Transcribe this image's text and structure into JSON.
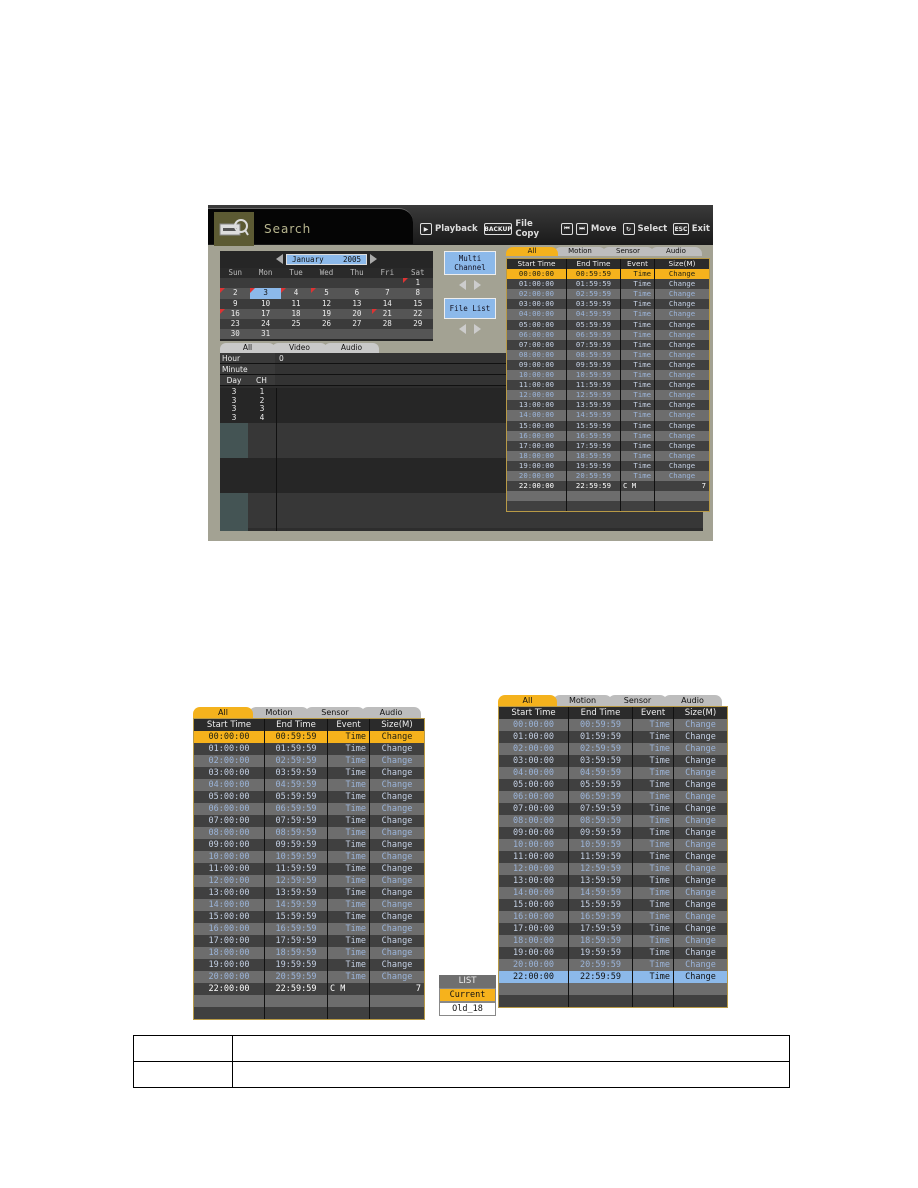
{
  "screen": {
    "title": "Search",
    "help": [
      {
        "key": "play-key",
        "icon": "▶",
        "label": "Playback"
      },
      {
        "key": "backup-key",
        "icon": "BACKUP",
        "label": "File Copy"
      },
      {
        "key": "move-keys",
        "icon": "◀▶",
        "label": "Move"
      },
      {
        "key": "select-key",
        "icon": "↻",
        "label": "Select"
      },
      {
        "key": "esc-key",
        "icon": "ESC",
        "label": "Exit"
      }
    ],
    "calendar": {
      "month": "January",
      "year": "2005",
      "weekdays": [
        "Sun",
        "Mon",
        "Tue",
        "Wed",
        "Thu",
        "Fri",
        "Sat"
      ],
      "weeks": [
        [
          "",
          "",
          "",
          "",
          "",
          "",
          "1"
        ],
        [
          "2",
          "3",
          "4",
          "5",
          "6",
          "7",
          "8"
        ],
        [
          "9",
          "10",
          "11",
          "12",
          "13",
          "14",
          "15"
        ],
        [
          "16",
          "17",
          "18",
          "19",
          "20",
          "21",
          "22"
        ],
        [
          "23",
          "24",
          "25",
          "26",
          "27",
          "28",
          "29"
        ],
        [
          "30",
          "31",
          "",
          "",
          "",
          "",
          ""
        ]
      ],
      "selected_day": "3",
      "marked_days": [
        "1",
        "2",
        "3",
        "4",
        "5",
        "16",
        "21"
      ]
    },
    "buttons": {
      "multi_channel": "Multi Channel",
      "file_list": "File List"
    },
    "lower_tabs": [
      "All",
      "Video",
      "Audio"
    ],
    "hour_label": "Hour",
    "hour_value": "0",
    "minute_label": "Minute",
    "day_label": "Day",
    "ch_label": "CH",
    "day_ch_rows": [
      {
        "day": "3",
        "ch": "1"
      },
      {
        "day": "3",
        "ch": "2"
      },
      {
        "day": "3",
        "ch": "3"
      },
      {
        "day": "3",
        "ch": "4"
      }
    ]
  },
  "event_table": {
    "tabs": [
      "All",
      "Motion",
      "Sensor",
      "Audio"
    ],
    "active_tab": "All",
    "columns": [
      "Start Time",
      "End Time",
      "Event",
      "Size(M)"
    ],
    "rows": [
      {
        "start": "00:00:00",
        "end": "00:59:59",
        "event": "Time",
        "size": "Change"
      },
      {
        "start": "01:00:00",
        "end": "01:59:59",
        "event": "Time",
        "size": "Change"
      },
      {
        "start": "02:00:00",
        "end": "02:59:59",
        "event": "Time",
        "size": "Change"
      },
      {
        "start": "03:00:00",
        "end": "03:59:59",
        "event": "Time",
        "size": "Change"
      },
      {
        "start": "04:00:00",
        "end": "04:59:59",
        "event": "Time",
        "size": "Change"
      },
      {
        "start": "05:00:00",
        "end": "05:59:59",
        "event": "Time",
        "size": "Change"
      },
      {
        "start": "06:00:00",
        "end": "06:59:59",
        "event": "Time",
        "size": "Change"
      },
      {
        "start": "07:00:00",
        "end": "07:59:59",
        "event": "Time",
        "size": "Change"
      },
      {
        "start": "08:00:00",
        "end": "08:59:59",
        "event": "Time",
        "size": "Change"
      },
      {
        "start": "09:00:00",
        "end": "09:59:59",
        "event": "Time",
        "size": "Change"
      },
      {
        "start": "10:00:00",
        "end": "10:59:59",
        "event": "Time",
        "size": "Change"
      },
      {
        "start": "11:00:00",
        "end": "11:59:59",
        "event": "Time",
        "size": "Change"
      },
      {
        "start": "12:00:00",
        "end": "12:59:59",
        "event": "Time",
        "size": "Change"
      },
      {
        "start": "13:00:00",
        "end": "13:59:59",
        "event": "Time",
        "size": "Change"
      },
      {
        "start": "14:00:00",
        "end": "14:59:59",
        "event": "Time",
        "size": "Change"
      },
      {
        "start": "15:00:00",
        "end": "15:59:59",
        "event": "Time",
        "size": "Change"
      },
      {
        "start": "16:00:00",
        "end": "16:59:59",
        "event": "Time",
        "size": "Change"
      },
      {
        "start": "17:00:00",
        "end": "17:59:59",
        "event": "Time",
        "size": "Change"
      },
      {
        "start": "18:00:00",
        "end": "18:59:59",
        "event": "Time",
        "size": "Change"
      },
      {
        "start": "19:00:00",
        "end": "19:59:59",
        "event": "Time",
        "size": "Change"
      },
      {
        "start": "20:00:00",
        "end": "20:59:59",
        "event": "Time",
        "size": "Change"
      }
    ],
    "last_row_cm": {
      "start": "22:00:00",
      "end": "22:59:59",
      "event": "C M",
      "size": "7"
    },
    "last_row_time": {
      "start": "22:00:00",
      "end": "22:59:59",
      "event": "Time",
      "size": "Change"
    }
  },
  "list_popup": {
    "title": "LIST",
    "items": [
      "Current",
      "Old_18"
    ],
    "selected": "Current"
  },
  "colors": {
    "accent_orange": "#f6b21c",
    "accent_blue": "#8cb9ea",
    "mark_red": "#dd3333"
  }
}
